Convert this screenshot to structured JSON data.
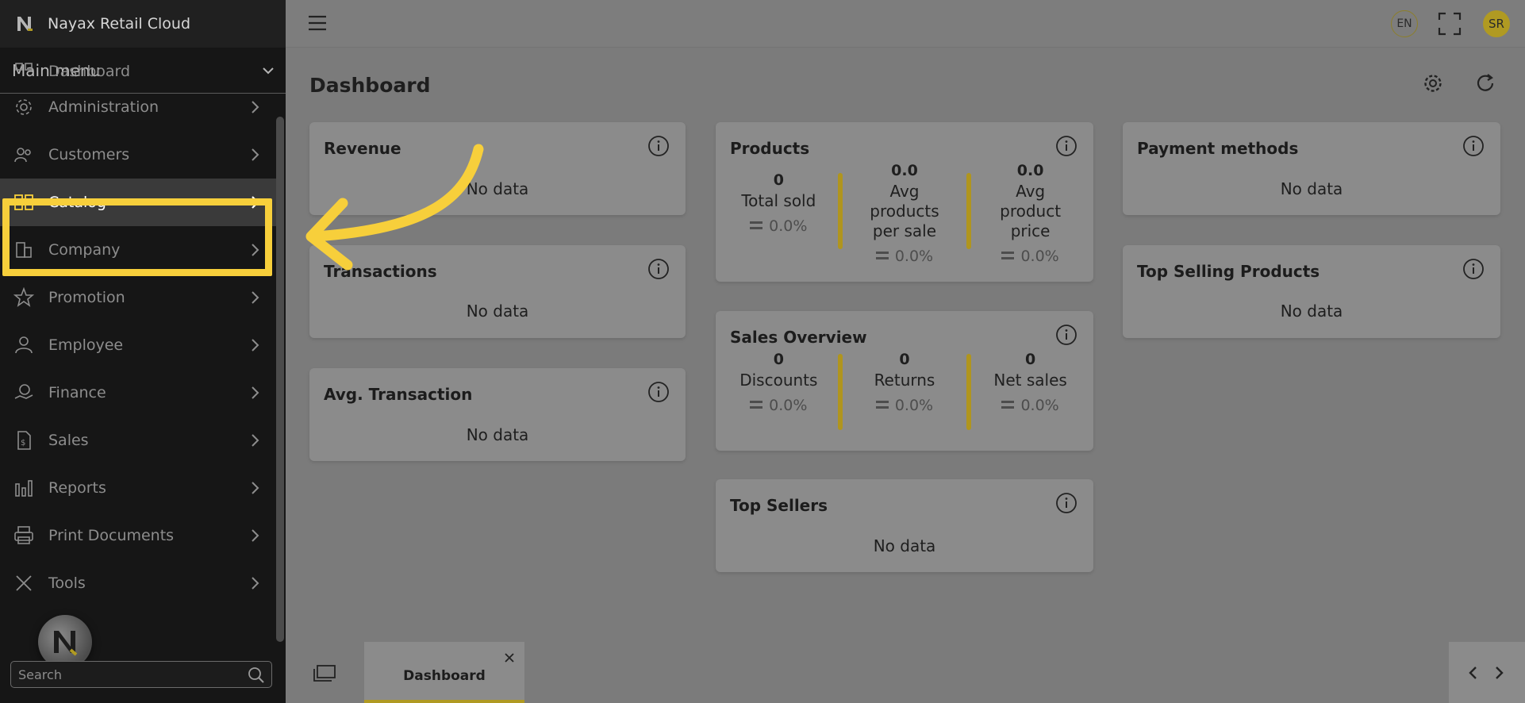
{
  "app": {
    "brand_title": "Nayax Retail Cloud"
  },
  "sidebar": {
    "main_menu_label": "Main menu",
    "items": [
      {
        "label": "Dashboard",
        "icon": "dashboard-icon"
      },
      {
        "label": "Administration",
        "icon": "gear-icon"
      },
      {
        "label": "Customers",
        "icon": "customers-icon"
      },
      {
        "label": "Catalog",
        "icon": "grid-icon",
        "active": true
      },
      {
        "label": "Company",
        "icon": "building-icon"
      },
      {
        "label": "Promotion",
        "icon": "star-icon"
      },
      {
        "label": "Employee",
        "icon": "person-icon"
      },
      {
        "label": "Finance",
        "icon": "finance-icon"
      },
      {
        "label": "Sales",
        "icon": "sales-icon"
      },
      {
        "label": "Reports",
        "icon": "bar-chart-icon"
      },
      {
        "label": "Print Documents",
        "icon": "printer-icon"
      },
      {
        "label": "Tools",
        "icon": "tools-icon"
      }
    ],
    "search_placeholder": "Search"
  },
  "topbar": {
    "language": "EN",
    "avatar_initials": "SR"
  },
  "main": {
    "page_title": "Dashboard",
    "no_data_text": "No data",
    "cards": {
      "revenue": {
        "title": "Revenue",
        "body": "No data"
      },
      "transactions": {
        "title": "Transactions",
        "body": "No data"
      },
      "avg_transaction": {
        "title": "Avg. Transaction",
        "body": "No data"
      },
      "products": {
        "title": "Products",
        "metrics": [
          {
            "value": "0",
            "label": "Total sold",
            "pct": "0.0%"
          },
          {
            "value": "0.0",
            "label": "Avg products per sale",
            "pct": "0.0%"
          },
          {
            "value": "0.0",
            "label": "Avg product price",
            "pct": "0.0%"
          }
        ]
      },
      "sales_overview": {
        "title": "Sales Overview",
        "metrics": [
          {
            "value": "0",
            "label": "Discounts",
            "pct": "0.0%"
          },
          {
            "value": "0",
            "label": "Returns",
            "pct": "0.0%"
          },
          {
            "value": "0",
            "label": "Net sales",
            "pct": "0.0%"
          }
        ]
      },
      "top_sellers": {
        "title": "Top Sellers",
        "body": "No data"
      },
      "payment_methods": {
        "title": "Payment methods",
        "body": "No data"
      },
      "top_selling_products": {
        "title": "Top Selling Products",
        "body": "No data"
      }
    }
  },
  "bottom_tabs": [
    {
      "label": "Dashboard"
    }
  ],
  "colors": {
    "highlight": "#f7cf3b",
    "accent": "#b09a22",
    "sidebar_bg": "#161616",
    "overlay_bg": "#7b7b7b"
  }
}
